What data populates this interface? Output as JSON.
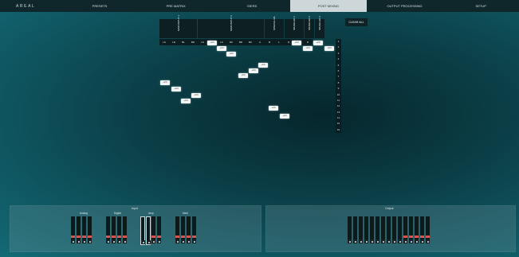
{
  "nav": {
    "brand": "AREAL",
    "tabs": [
      "PRESETS",
      "PRE MATRIX",
      "EIERS",
      "POST MIXING",
      "OUTPUT PROCESSING",
      "SETUP"
    ],
    "active_tab": 3
  },
  "matrix": {
    "groups": [
      "MAIN INPUT 1",
      "MAIN INPUT 2",
      "SPECIAL R/L",
      "SNAKE ED 1",
      "SNAKE ED 2",
      "SNAKE ED 3"
    ],
    "channel_labels": [
      "LS",
      "LR",
      "BL",
      "BR",
      "LS",
      "LR",
      "LC",
      "RC",
      "BR",
      "BC",
      "A",
      "B",
      "L",
      "R",
      "L",
      "R"
    ],
    "row_labels": [
      "1",
      "2",
      "3",
      "4",
      "5",
      "6",
      "7",
      "8",
      "9",
      "10",
      "11",
      "12",
      "13",
      "14",
      "15",
      "16"
    ],
    "cells": [
      {
        "v": "+0.0"
      },
      {
        "v": "+0.0"
      },
      {
        "v": "+0.0"
      },
      {
        "v": "+0.0"
      },
      {
        "v": "+0.0"
      },
      {
        "v": "+0.0"
      },
      {
        "v": "+0.0"
      },
      {
        "v": "+0.0"
      },
      {
        "v": "+0.0"
      },
      {
        "v": "+0.0"
      },
      {
        "v": "+0.0"
      },
      {
        "v": "+0.0"
      },
      {
        "v": "+0.0"
      },
      {
        "v": "+0.0"
      },
      {
        "v": "+0.0"
      },
      {
        "v": "+0.0"
      }
    ]
  },
  "clear_all": "CLEAR ALL",
  "input_panel": {
    "title": "Input",
    "groups": [
      "Analog",
      "Digital",
      "Aerp",
      "Medi"
    ]
  },
  "output_panel": {
    "title": "Output"
  }
}
